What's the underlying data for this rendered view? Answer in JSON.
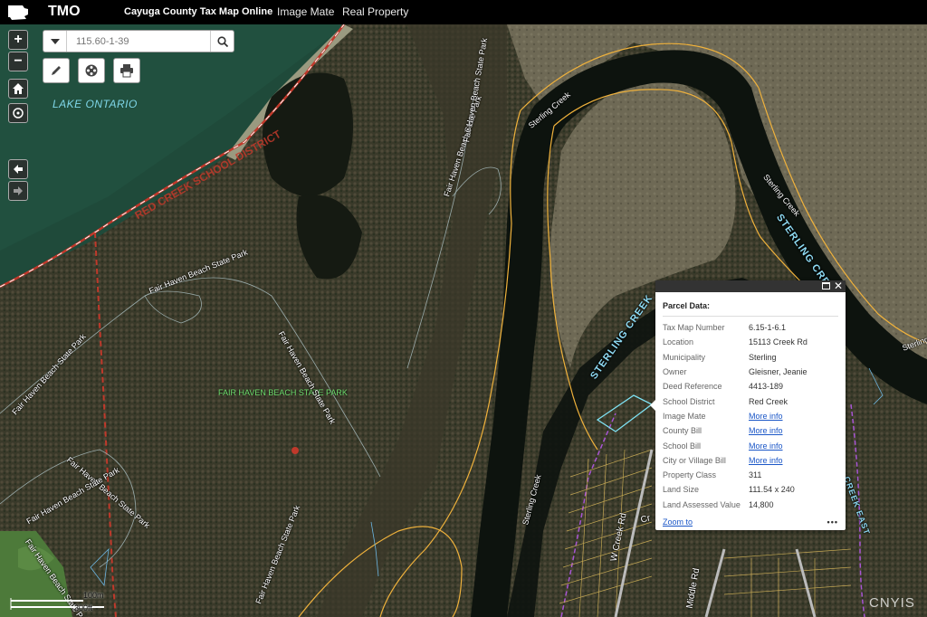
{
  "header": {
    "app_name": "TMO",
    "app_title": "Cayuga County Tax Map Online",
    "nav": [
      "Image Mate",
      "Real Property"
    ]
  },
  "search": {
    "placeholder": "115.60-1-39"
  },
  "controls": {
    "zoom_in": "+",
    "zoom_out": "−"
  },
  "map_labels": {
    "lake": "LAKE ONTARIO",
    "district": "RED CREEK SCHOOL DISTRICT",
    "park_center": "FAIR HAVEN BEACH STATE PARK",
    "park_roads": [
      "Fair Haven Beach State Park",
      "Fair Haven Beach State Park",
      "Fair Haven Beach State Park",
      "Fair Haven Beach State Park",
      "Fair Haven Beach State Park",
      "Fair Haven Beach State Park",
      "Fair Haven Beach State Park",
      "Fair Haven Beach State Park",
      "Fair Haven Beach State Park"
    ],
    "creek": [
      "Sterling Creek",
      "Sterling Creek",
      "Sterling Creek",
      "Sterling"
    ],
    "creek_big": [
      "STERLING CREEK",
      "STERLING CREEK",
      "CREEK EAST"
    ],
    "roads": [
      "W Creek Rd",
      "Cr",
      "Middle Rd"
    ]
  },
  "scale": {
    "top": "100m",
    "bottom": "300ft"
  },
  "popup": {
    "title": "Parcel Data:",
    "rows": [
      {
        "key": "Tax Map Number",
        "value": "6.15-1-6.1"
      },
      {
        "key": "Location",
        "value": "15113 Creek Rd"
      },
      {
        "key": "Municipality",
        "value": "Sterling"
      },
      {
        "key": "Owner",
        "value": "Gleisner, Jeanie"
      },
      {
        "key": "Deed Reference",
        "value": "4413-189"
      },
      {
        "key": "School District",
        "value": "Red Creek"
      },
      {
        "key": "Image Mate",
        "value": "More info"
      },
      {
        "key": "County Bill",
        "value": "More info"
      },
      {
        "key": "School Bill",
        "value": "More info"
      },
      {
        "key": "City or Village Bill",
        "value": "More info"
      },
      {
        "key": "Property Class",
        "value": "311"
      },
      {
        "key": "Land Size",
        "value": "111.54 x 240"
      },
      {
        "key": "Land Assessed Value",
        "value": "14,800"
      }
    ],
    "zoom_to": "Zoom to",
    "more": "•••"
  },
  "watermark": "CNYIS",
  "colors": {
    "topbar": "#000000",
    "lake": "#1f4a3a",
    "forest": "#2b3520",
    "water": "#0e1410",
    "marsh": "#6b6650",
    "parcel_line": "#d9b85a",
    "creek_line": "#f0b23c",
    "link": "#1a56c7",
    "district_line": "#c0392b"
  }
}
